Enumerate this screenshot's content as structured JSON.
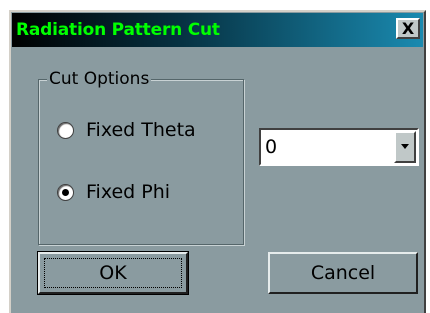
{
  "window": {
    "title": "Radiation Pattern Cut",
    "title_color": "#00ff00",
    "close_label": "X"
  },
  "cut_options": {
    "legend": "Cut Options",
    "options": [
      {
        "label": "Fixed Theta",
        "selected": false
      },
      {
        "label": "Fixed Phi",
        "selected": true
      }
    ]
  },
  "angle_select": {
    "value": "0",
    "icon": "chevron-down-icon"
  },
  "buttons": {
    "ok_label": "OK",
    "cancel_label": "Cancel"
  },
  "colors": {
    "dialog_bg": "#8a9ba0",
    "title_gradient_end": "#1a8ab0"
  }
}
